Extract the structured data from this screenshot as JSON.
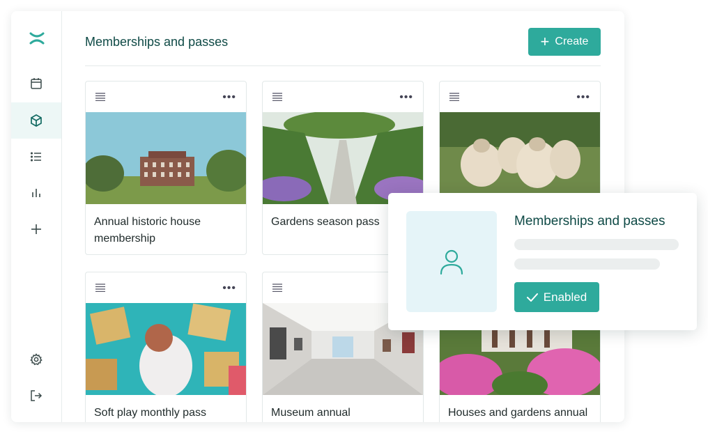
{
  "page": {
    "title": "Memberships and passes"
  },
  "toolbar": {
    "create_label": "Create"
  },
  "sidebar": {
    "items": [
      {
        "name": "calendar-icon"
      },
      {
        "name": "package-icon",
        "active": true
      },
      {
        "name": "list-icon"
      },
      {
        "name": "bar-chart-icon"
      },
      {
        "name": "plus-icon"
      }
    ],
    "bottom": [
      {
        "name": "gear-icon"
      },
      {
        "name": "logout-icon"
      }
    ]
  },
  "cards": [
    {
      "title": "Annual historic house membership",
      "image": "historic-house-photo"
    },
    {
      "title": "Gardens season pass",
      "image": "gardens-photo"
    },
    {
      "title": "",
      "image": "sheep-photo"
    },
    {
      "title": "Soft play monthly pass",
      "image": "soft-play-photo"
    },
    {
      "title": "Museum annual membership",
      "image": "museum-photo"
    },
    {
      "title": "Houses and gardens annual",
      "image": "house-gardens-photo"
    }
  ],
  "popup": {
    "title": "Memberships and passes",
    "status_label": "Enabled",
    "avatar_icon": "user-icon"
  },
  "colors": {
    "accent": "#2eaa9c",
    "title": "#0f4a46"
  }
}
